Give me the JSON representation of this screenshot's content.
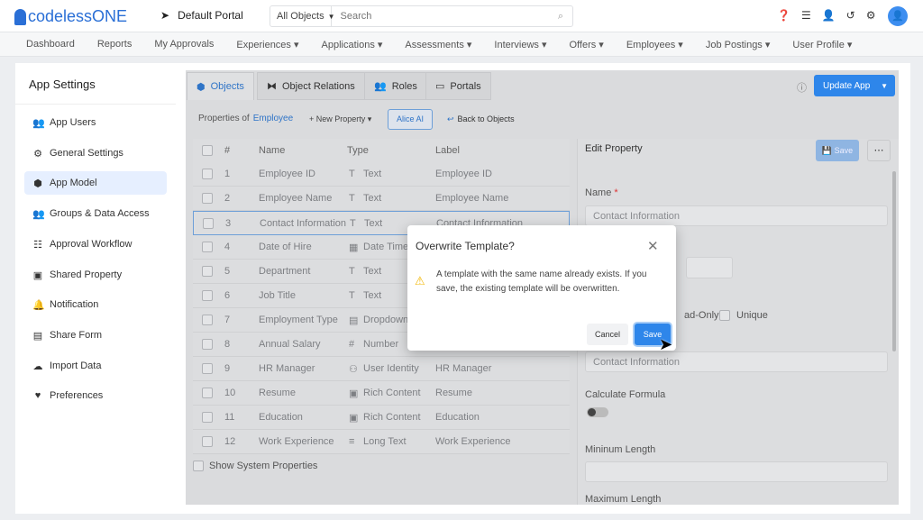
{
  "header": {
    "logo": "codelessONE",
    "portal": "Default Portal",
    "search_scope": "All Objects",
    "search_placeholder": "Search"
  },
  "nav": [
    "Dashboard",
    "Reports",
    "My Approvals",
    "Experiences ▾",
    "Applications ▾",
    "Assessments ▾",
    "Interviews ▾",
    "Offers ▾",
    "Employees ▾",
    "Job Postings ▾",
    "User Profile ▾"
  ],
  "sidebar": {
    "title": "App Settings",
    "items": [
      {
        "label": "App Users",
        "icon": "👥"
      },
      {
        "label": "General Settings",
        "icon": "⚙"
      },
      {
        "label": "App Model",
        "icon": "⬢"
      },
      {
        "label": "Groups & Data Access",
        "icon": "👥"
      },
      {
        "label": "Approval Workflow",
        "icon": "☷"
      },
      {
        "label": "Shared Property",
        "icon": "▣"
      },
      {
        "label": "Notification",
        "icon": "🔔"
      },
      {
        "label": "Share Form",
        "icon": "▤"
      },
      {
        "label": "Import Data",
        "icon": "☁"
      },
      {
        "label": "Preferences",
        "icon": "♥"
      }
    ],
    "active": "App Model"
  },
  "tabs": [
    "Objects",
    "Object Relations",
    "Roles",
    "Portals"
  ],
  "update_app": "Update App",
  "toolbar": {
    "properties_of": "Properties of",
    "object": "Employee",
    "new_property": "+ New Property ▾",
    "alice_ai": "Alice AI",
    "back": "Back to Objects"
  },
  "table": {
    "headers": [
      "#",
      "Name",
      "Type",
      "Label"
    ],
    "rows": [
      [
        "1",
        "Employee ID",
        "T",
        "Text",
        "Employee ID"
      ],
      [
        "2",
        "Employee Name",
        "T",
        "Text",
        "Employee Name"
      ],
      [
        "3",
        "Contact Information",
        "T",
        "Text",
        "Contact Information"
      ],
      [
        "4",
        "Date of Hire",
        "▦",
        "Date Time",
        ""
      ],
      [
        "5",
        "Department",
        "T",
        "Text",
        ""
      ],
      [
        "6",
        "Job Title",
        "T",
        "Text",
        ""
      ],
      [
        "7",
        "Employment Type",
        "▤",
        "Dropdown",
        ""
      ],
      [
        "8",
        "Annual Salary",
        "#",
        "Number",
        ""
      ],
      [
        "9",
        "HR Manager",
        "⚇",
        "User Identity",
        "HR Manager"
      ],
      [
        "10",
        "Resume",
        "▣",
        "Rich Content",
        "Resume"
      ],
      [
        "11",
        "Education",
        "▣",
        "Rich Content",
        "Education"
      ],
      [
        "12",
        "Work Experience",
        "≡",
        "Long Text",
        "Work Experience"
      ]
    ],
    "show_system": "Show System Properties"
  },
  "edit": {
    "title": "Edit Property",
    "save": "Save",
    "name_label": "Name",
    "name_value": "Contact Information",
    "readonly": "ad-Only",
    "unique": "Unique",
    "label_value": "Contact Information",
    "calc": "Calculate Formula",
    "min": "Mininum Length",
    "max": "Maximum Length"
  },
  "dialog": {
    "title": "Overwrite Template?",
    "message": "A template with the same name already exists. If you save, the existing template will be overwritten.",
    "cancel": "Cancel",
    "save": "Save"
  }
}
